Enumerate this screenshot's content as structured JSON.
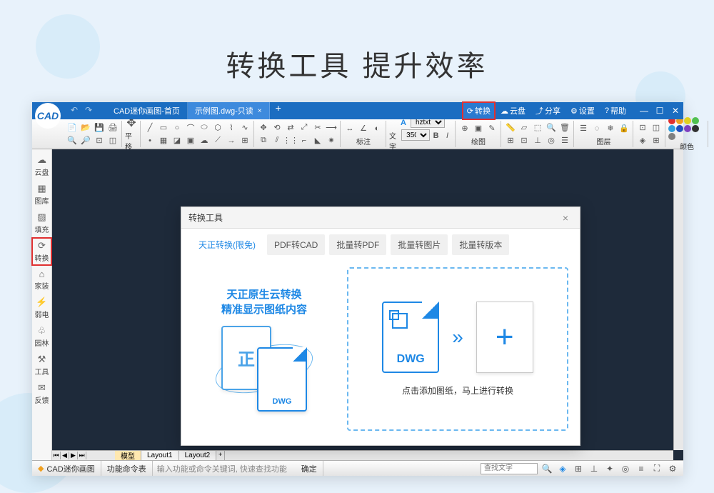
{
  "hero": {
    "title": "转换工具 提升效率"
  },
  "titlebar": {
    "tab_home": "CAD迷你画图-首页",
    "tab_active": "示例图.dwg-只读",
    "btn_convert": "转换",
    "btn_cloud": "云盘",
    "btn_share": "分享",
    "btn_settings": "设置",
    "btn_help": "帮助"
  },
  "ribbon": {
    "pan_label": "平移",
    "font_select": "hztxt",
    "size_select": "350",
    "text_label": "文字",
    "annotate_label": "标注",
    "draw_label": "绘图",
    "layer_label": "图层",
    "color_label": "颜色",
    "colors": [
      "#e03030",
      "#f0a020",
      "#e0d020",
      "#50c050",
      "#30a0e0",
      "#2050c0",
      "#8040c0",
      "#303030",
      "#808080"
    ]
  },
  "sidebar": {
    "items": [
      {
        "icon": "☁",
        "label": "云盘"
      },
      {
        "icon": "▦",
        "label": "图库"
      },
      {
        "icon": "▨",
        "label": "填充"
      },
      {
        "icon": "⟳",
        "label": "转换"
      },
      {
        "icon": "⌂",
        "label": "家装"
      },
      {
        "icon": "⚡",
        "label": "弱电"
      },
      {
        "icon": "♧",
        "label": "园林"
      },
      {
        "icon": "⚒",
        "label": "工具"
      },
      {
        "icon": "✉",
        "label": "反馈"
      }
    ]
  },
  "layouts": {
    "model": "模型",
    "layout1": "Layout1",
    "layout2": "Layout2"
  },
  "statusbar": {
    "app_name": "CAD迷你画图",
    "cmd_label": "功能命令表",
    "cmd_placeholder": "输入功能或命令关键词, 快速查找功能",
    "confirm": "确定",
    "search_placeholder": "查找文字"
  },
  "modal": {
    "title": "转换工具",
    "tabs": [
      "天正转换(限免)",
      "PDF转CAD",
      "批量转PDF",
      "批量转图片",
      "批量转版本"
    ],
    "promo_line1": "天正原生云转换",
    "promo_line2": "精准显示图纸内容",
    "dwg_label": "DWG",
    "drop_text": "点击添加图纸，马上进行转换"
  }
}
